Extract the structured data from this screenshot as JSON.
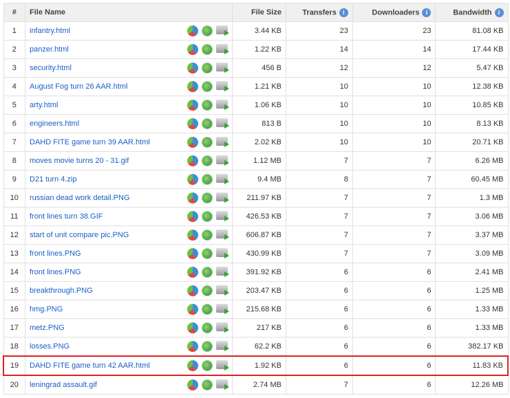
{
  "headers": {
    "num": "#",
    "name": "File Name",
    "size": "File Size",
    "transfers": "Transfers",
    "downloaders": "Downloaders",
    "bandwidth": "Bandwidth",
    "info_glyph": "i"
  },
  "highlight_color": "#e02020",
  "rows": [
    {
      "n": "1",
      "name": "infantry.html",
      "size": "3.44 KB",
      "t": "23",
      "d": "23",
      "b": "81.08 KB"
    },
    {
      "n": "2",
      "name": "panzer.html",
      "size": "1.22 KB",
      "t": "14",
      "d": "14",
      "b": "17.44 KB"
    },
    {
      "n": "3",
      "name": "security.html",
      "size": "456 B",
      "t": "12",
      "d": "12",
      "b": "5.47 KB"
    },
    {
      "n": "4",
      "name": "August Fog turn 26 AAR.html",
      "size": "1.21 KB",
      "t": "10",
      "d": "10",
      "b": "12.38 KB"
    },
    {
      "n": "5",
      "name": "arty.html",
      "size": "1.06 KB",
      "t": "10",
      "d": "10",
      "b": "10.85 KB"
    },
    {
      "n": "6",
      "name": "engineers.html",
      "size": "813 B",
      "t": "10",
      "d": "10",
      "b": "8.13 KB"
    },
    {
      "n": "7",
      "name": "DAHD FITE game turn 39 AAR.html",
      "size": "2.02 KB",
      "t": "10",
      "d": "10",
      "b": "20.71 KB"
    },
    {
      "n": "8",
      "name": "moves movie turns 20 - 31.gif",
      "size": "1.12 MB",
      "t": "7",
      "d": "7",
      "b": "6.26 MB"
    },
    {
      "n": "9",
      "name": "D21 turn 4.zip",
      "size": "9.4 MB",
      "t": "8",
      "d": "7",
      "b": "60.45 MB"
    },
    {
      "n": "10",
      "name": "russian dead work detail.PNG",
      "size": "211.97 KB",
      "t": "7",
      "d": "7",
      "b": "1.3 MB"
    },
    {
      "n": "11",
      "name": "front lines turn 38.GIF",
      "size": "426.53 KB",
      "t": "7",
      "d": "7",
      "b": "3.06 MB"
    },
    {
      "n": "12",
      "name": "start of unit compare pic.PNG",
      "size": "606.87 KB",
      "t": "7",
      "d": "7",
      "b": "3.37 MB"
    },
    {
      "n": "13",
      "name": "front lines.PNG",
      "size": "430.99 KB",
      "t": "7",
      "d": "7",
      "b": "3.09 MB"
    },
    {
      "n": "14",
      "name": "front lines.PNG",
      "size": "391.92 KB",
      "t": "6",
      "d": "6",
      "b": "2.41 MB"
    },
    {
      "n": "15",
      "name": "breakthrough.PNG",
      "size": "203.47 KB",
      "t": "6",
      "d": "6",
      "b": "1.25 MB"
    },
    {
      "n": "16",
      "name": "hmg.PNG",
      "size": "215.68 KB",
      "t": "6",
      "d": "6",
      "b": "1.33 MB"
    },
    {
      "n": "17",
      "name": "metz.PNG",
      "size": "217 KB",
      "t": "6",
      "d": "6",
      "b": "1.33 MB"
    },
    {
      "n": "18",
      "name": "losses.PNG",
      "size": "62.2 KB",
      "t": "6",
      "d": "6",
      "b": "382.17 KB"
    },
    {
      "n": "19",
      "name": "DAHD FITE game turn 42 AAR.html",
      "size": "1.92 KB",
      "t": "6",
      "d": "6",
      "b": "11.83 KB",
      "highlighted": true
    },
    {
      "n": "20",
      "name": "leningrad assault.gif",
      "size": "2.74 MB",
      "t": "7",
      "d": "6",
      "b": "12.26 MB"
    }
  ]
}
